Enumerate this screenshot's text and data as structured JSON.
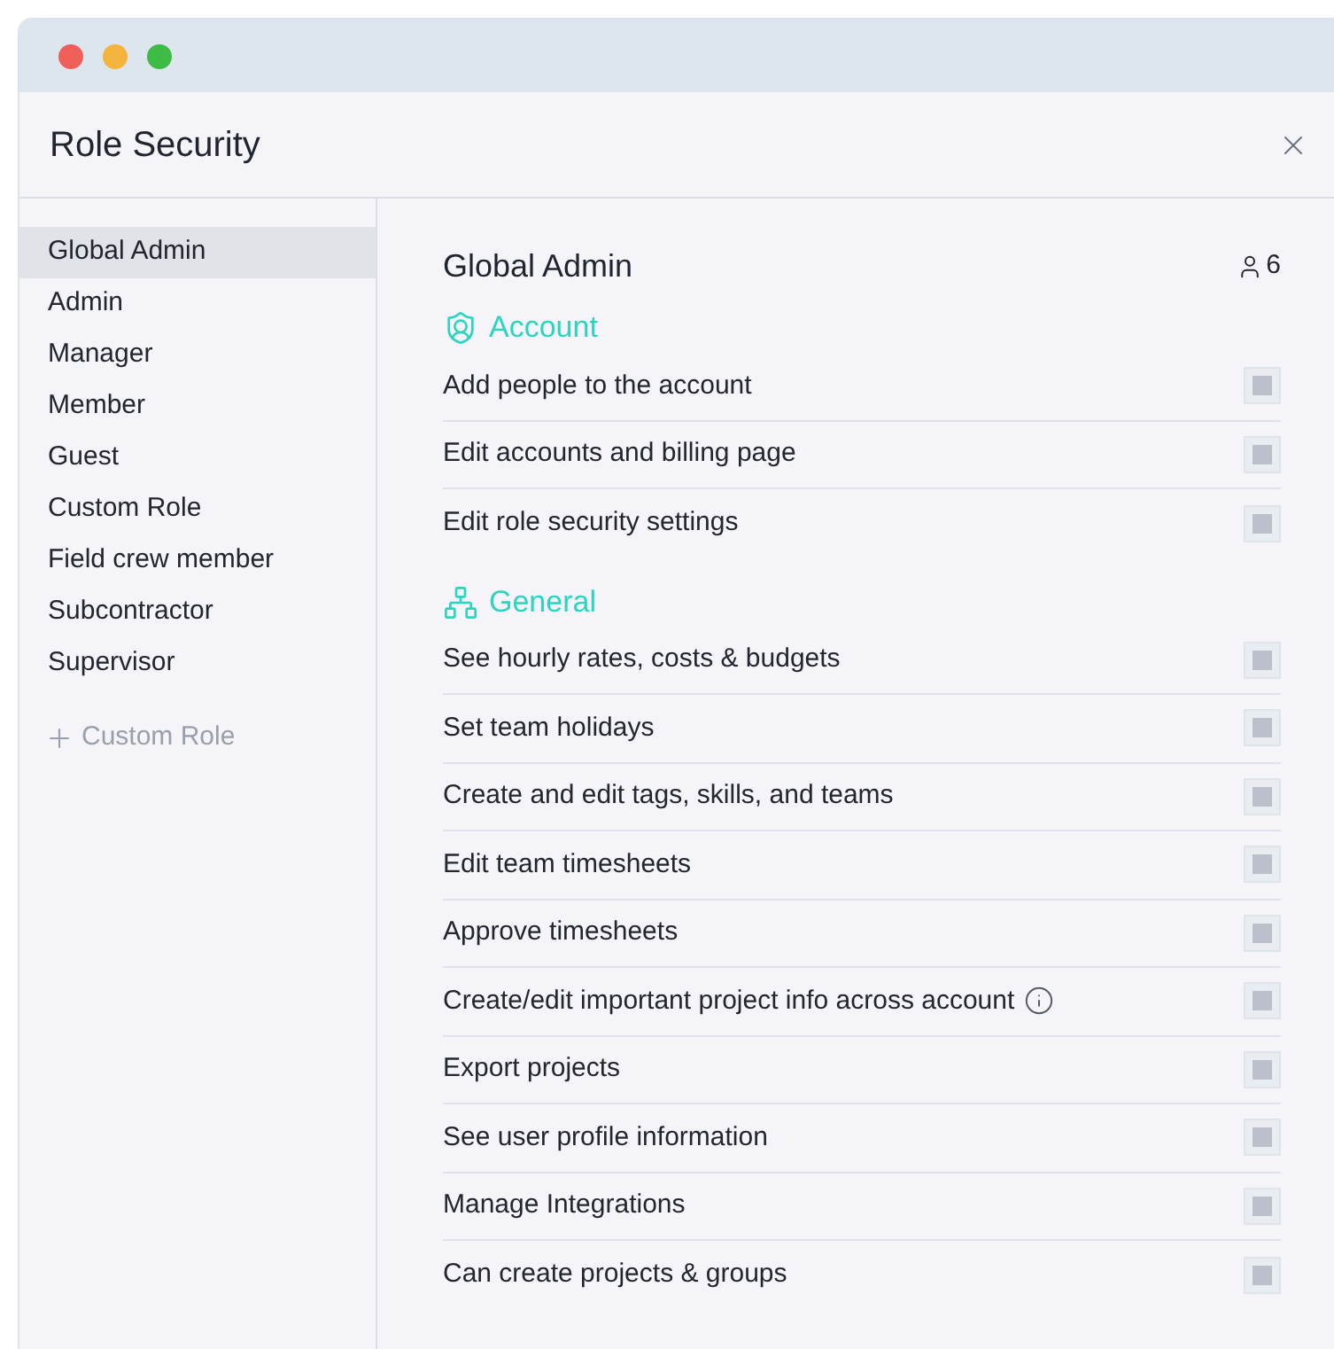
{
  "window": {
    "title": "Role Security"
  },
  "sidebar": {
    "items": [
      {
        "label": "Global Admin",
        "selected": true
      },
      {
        "label": "Admin",
        "selected": false
      },
      {
        "label": "Manager",
        "selected": false
      },
      {
        "label": "Member",
        "selected": false
      },
      {
        "label": "Guest",
        "selected": false
      },
      {
        "label": "Custom Role",
        "selected": false
      },
      {
        "label": "Field crew member",
        "selected": false
      },
      {
        "label": "Subcontractor",
        "selected": false
      },
      {
        "label": "Supervisor",
        "selected": false
      }
    ],
    "add_button": {
      "label": "Custom Role"
    }
  },
  "content": {
    "title": "Global Admin",
    "member_count": "6",
    "sections": [
      {
        "kind": "account",
        "title": "Account",
        "permissions": [
          {
            "label": "Add people to the account",
            "info": false,
            "disabled": true
          },
          {
            "label": "Edit accounts and billing page",
            "info": false,
            "disabled": true
          },
          {
            "label": "Edit role security settings",
            "info": false,
            "disabled": true
          }
        ]
      },
      {
        "kind": "general",
        "title": "General",
        "permissions": [
          {
            "label": "See hourly rates, costs & budgets",
            "info": false,
            "disabled": true
          },
          {
            "label": "Set team holidays",
            "info": false,
            "disabled": true
          },
          {
            "label": "Create and edit tags, skills, and teams",
            "info": false,
            "disabled": true
          },
          {
            "label": "Edit team timesheets",
            "info": false,
            "disabled": true
          },
          {
            "label": "Approve timesheets",
            "info": false,
            "disabled": true
          },
          {
            "label": "Create/edit important project info across account",
            "info": true,
            "disabled": true
          },
          {
            "label": "Export projects",
            "info": false,
            "disabled": true
          },
          {
            "label": "See user profile information",
            "info": false,
            "disabled": true
          },
          {
            "label": "Manage Integrations",
            "info": false,
            "disabled": true
          },
          {
            "label": "Can create projects & groups",
            "info": false,
            "disabled": true
          }
        ]
      }
    ]
  }
}
